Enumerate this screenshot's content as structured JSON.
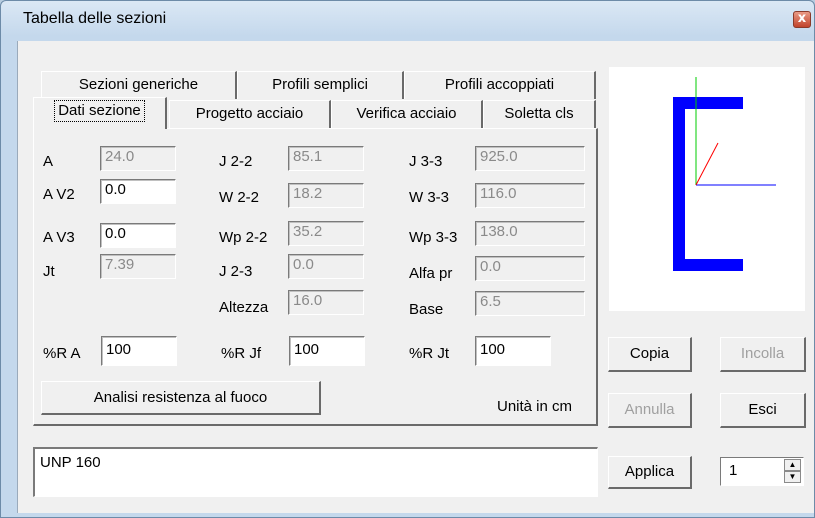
{
  "window": {
    "title": "Tabella delle sezioni",
    "close_glyph": "x"
  },
  "tabs": {
    "row1": [
      "Sezioni generiche",
      "Profili semplici",
      "Profili accoppiati"
    ],
    "row2": [
      "Dati sezione",
      "Progetto acciaio",
      "Verifica acciaio",
      "Soletta cls"
    ],
    "selected": "Dati sezione"
  },
  "fields": {
    "a": {
      "label": "A",
      "value": "24.0"
    },
    "av2": {
      "label": "A V2",
      "value": "0.0"
    },
    "av3": {
      "label": "A V3",
      "value": "0.0"
    },
    "jt": {
      "label": "Jt",
      "value": "7.39"
    },
    "j22": {
      "label": "J 2-2",
      "value": "85.1"
    },
    "w22": {
      "label": "W 2-2",
      "value": "18.2"
    },
    "wp22": {
      "label": "Wp 2-2",
      "value": "35.2"
    },
    "j23": {
      "label": "J 2-3",
      "value": "0.0"
    },
    "altezza": {
      "label": "Altezza",
      "value": "16.0"
    },
    "j33": {
      "label": "J 3-3",
      "value": "925.0"
    },
    "w33": {
      "label": "W 3-3",
      "value": "116.0"
    },
    "wp33": {
      "label": "Wp 3-3",
      "value": "138.0"
    },
    "alfapr": {
      "label": "Alfa pr",
      "value": "0.0"
    },
    "base": {
      "label": "Base",
      "value": "6.5"
    },
    "ra": {
      "label": "%R A",
      "value": "100"
    },
    "rjf": {
      "label": "%R Jf",
      "value": "100"
    },
    "rjt": {
      "label": "%R Jt",
      "value": "100"
    }
  },
  "buttons": {
    "fire": "Analisi resistenza al fuoco",
    "copy": "Copia",
    "paste": "Incolla",
    "cancel": "Annulla",
    "exit": "Esci",
    "apply": "Applica"
  },
  "units_label": "Unità in cm",
  "section_name": "UNP  160",
  "spinner": {
    "value": "1"
  },
  "colors": {
    "profile": "#0000ff",
    "axis_horizontal": "#0000ff",
    "axis_vertical": "#00cc00",
    "axis_diagonal": "#ff0000"
  }
}
